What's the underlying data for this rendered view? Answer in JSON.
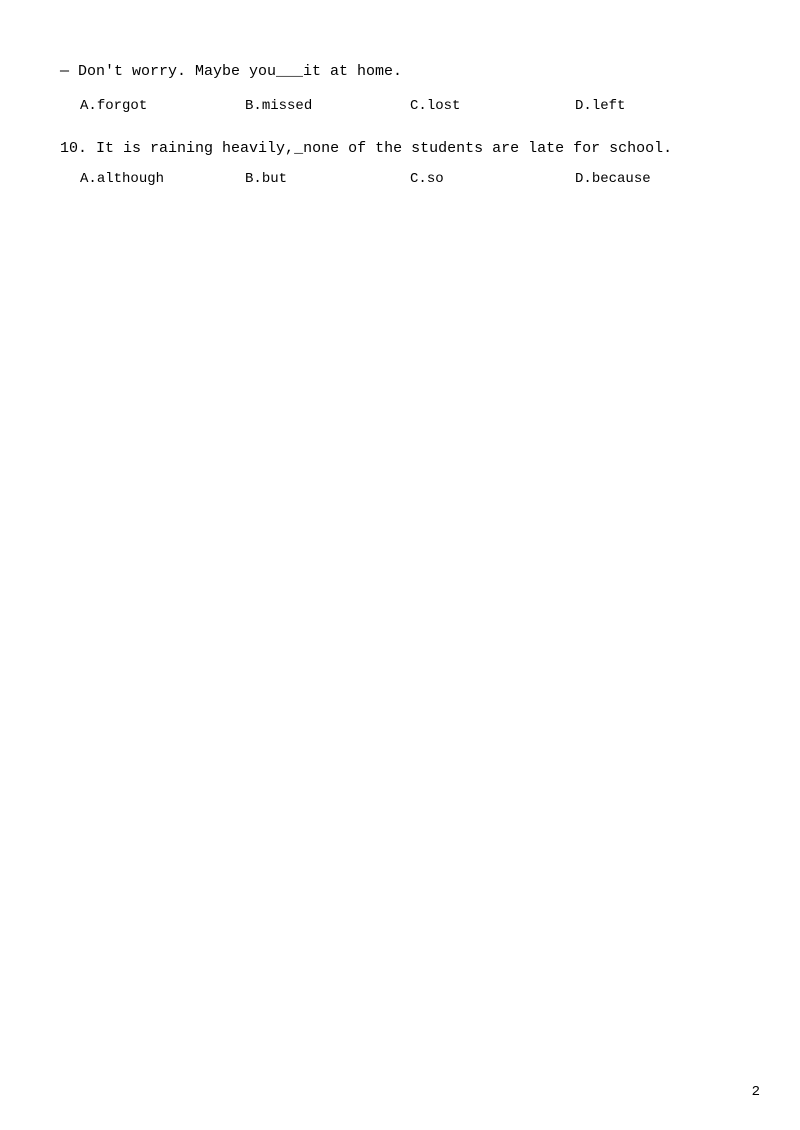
{
  "questions": [
    {
      "id": "q9_dialogue",
      "text": "— Don't worry. Maybe you___it at home.",
      "options": [
        {
          "label": "A.",
          "value": "forgot"
        },
        {
          "label": "B.",
          "value": "missed"
        },
        {
          "label": "C.",
          "value": "lost"
        },
        {
          "label": "D.",
          "value": "left"
        }
      ]
    },
    {
      "id": "q10",
      "number": "10.",
      "text": "It is raining heavily,_none of the students are late for school.",
      "options": [
        {
          "label": "A.",
          "value": "although"
        },
        {
          "label": "B.",
          "value": "but"
        },
        {
          "label": "C.",
          "value": "so"
        },
        {
          "label": "D.",
          "value": "because"
        }
      ]
    }
  ],
  "page_number": "2"
}
